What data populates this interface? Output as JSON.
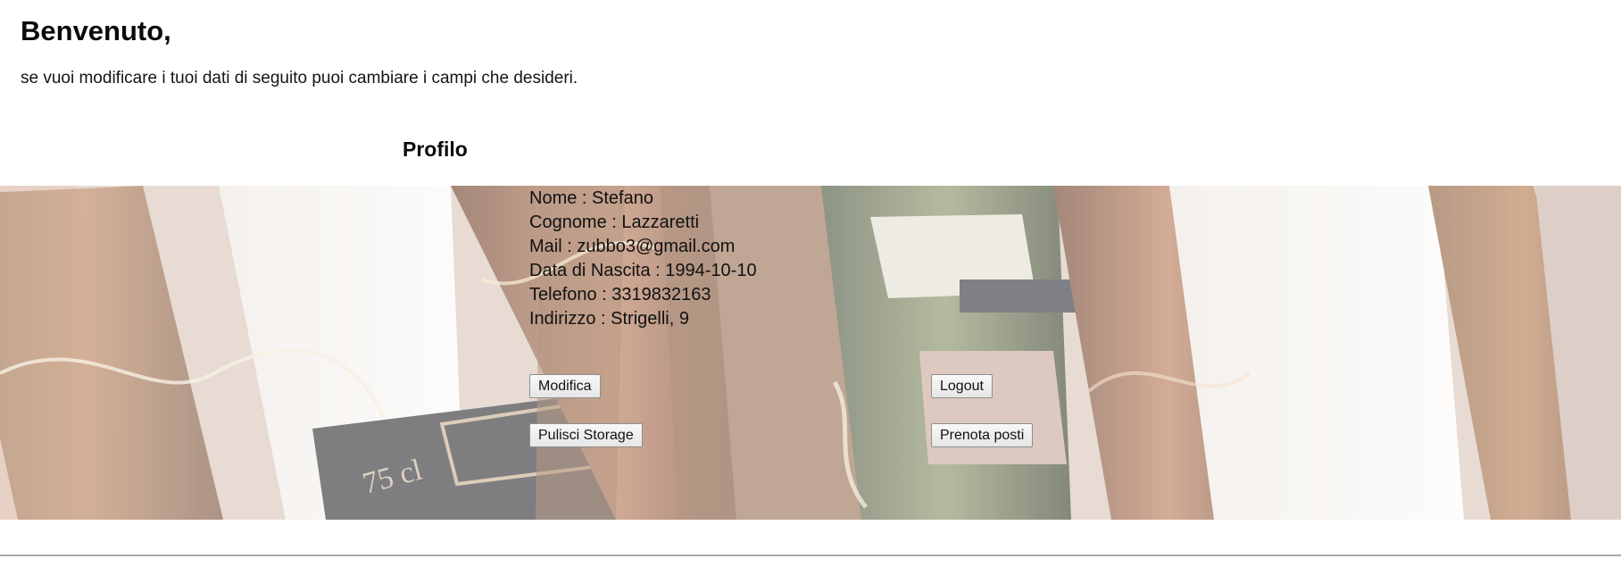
{
  "welcome": {
    "title": "Benvenuto,",
    "text": "se vuoi modificare i tuoi dati di seguito puoi cambiare i campi che desideri."
  },
  "profile": {
    "heading": "Profilo",
    "fields": [
      "Nome : Stefano",
      "Cognome : Lazzaretti",
      "Mail : zubbo3@gmail.com",
      "Data di Nascita : 1994-10-10",
      "Telefono : 3319832163",
      "Indirizzo : Strigelli, 9"
    ],
    "background_label": "75 cl"
  },
  "buttons": {
    "modifica": "Modifica",
    "logout": "Logout",
    "pulisci_storage": "Pulisci Storage",
    "prenota_posti": "Prenota posti"
  },
  "colors": {
    "page_background": "#ffffff",
    "text": "#111111",
    "button_border": "#8f8f8f"
  },
  "icons": {
    "background": "wine-bottles-image"
  }
}
